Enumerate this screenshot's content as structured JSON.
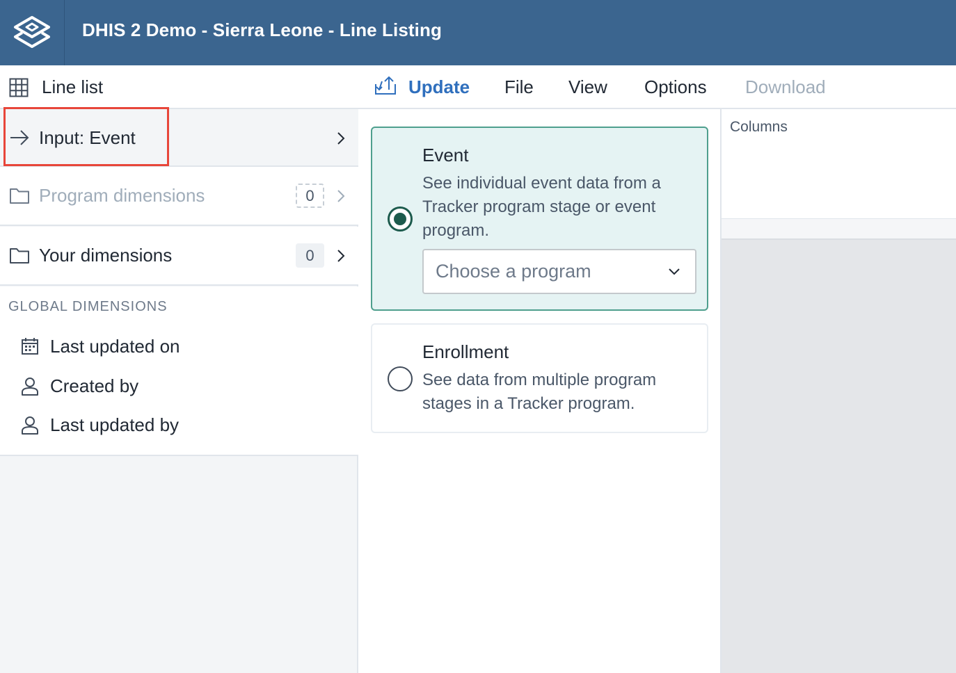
{
  "header": {
    "title": "DHIS 2 Demo - Sierra Leone - Line Listing",
    "logo_icon": "dhis2-logo-icon",
    "background_color": "#3b658f"
  },
  "sidebar": {
    "visualization_type": {
      "label": "Line list",
      "icon": "table-grid-icon"
    },
    "input": {
      "label": "Input: Event",
      "icon": "arrow-right-icon"
    },
    "program_dimensions": {
      "label": "Program dimensions",
      "count": "0",
      "icon": "folder-icon"
    },
    "your_dimensions": {
      "label": "Your dimensions",
      "count": "0",
      "icon": "folder-icon"
    },
    "global_dimensions": {
      "heading": "GLOBAL DIMENSIONS",
      "items": [
        {
          "label": "Last updated on",
          "icon": "calendar-icon"
        },
        {
          "label": "Created by",
          "icon": "user-icon"
        },
        {
          "label": "Last updated by",
          "icon": "user-icon"
        }
      ]
    }
  },
  "toolbar": {
    "update": "Update",
    "file": "File",
    "view": "View",
    "options": "Options",
    "download": "Download",
    "accent_color": "#2f6fbd"
  },
  "input_panel": {
    "event": {
      "title": "Event",
      "description": "See individual event data from a Tracker program stage or event program.",
      "selected": true,
      "program_select_placeholder": "Choose a program"
    },
    "enrollment": {
      "title": "Enrollment",
      "description": "See data from multiple program stages in a Tracker program.",
      "selected": false
    }
  },
  "layout": {
    "columns_label": "Columns"
  }
}
